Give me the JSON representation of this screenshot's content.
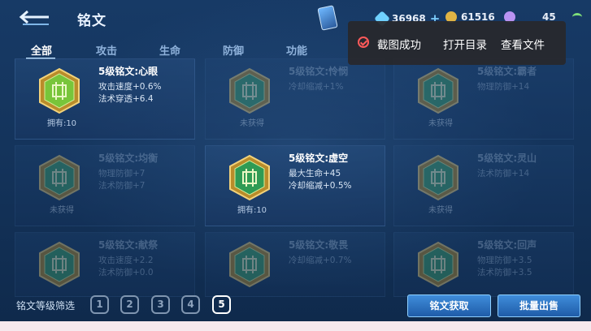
{
  "header": {
    "title": "铭文"
  },
  "resources": [
    {
      "name": "diamond",
      "value": "36968",
      "plus": "+"
    },
    {
      "name": "coupon",
      "value": "61516"
    },
    {
      "name": "gem",
      "value": "45"
    }
  ],
  "tabs": [
    {
      "label": "全部",
      "active": true
    },
    {
      "label": "攻击"
    },
    {
      "label": "生命"
    },
    {
      "label": "防御"
    },
    {
      "label": "功能"
    }
  ],
  "cards": [
    {
      "name": "5级铭文:心眼",
      "attrs": [
        "攻击速度+0.6%",
        "法术穿透+6.4"
      ],
      "owned": "拥有:10",
      "dim": false,
      "color": "#78c53a"
    },
    {
      "name": "5级铭文:怜悯",
      "attrs": [
        "冷却缩减+1%"
      ],
      "owned": "未获得",
      "dim": true,
      "color": "#3ea36a"
    },
    {
      "name": "5级铭文:霸者",
      "attrs": [
        "物理防御+14"
      ],
      "owned": "未获得",
      "dim": true,
      "color": "#3ea36a"
    },
    {
      "name": "5级铭文:均衡",
      "attrs": [
        "物理防御+7",
        "法术防御+7"
      ],
      "owned": "未获得",
      "dim": true,
      "color": "#3ea36a"
    },
    {
      "name": "5级铭文:虚空",
      "attrs": [
        "最大生命+45",
        "冷却缩减+0.5%"
      ],
      "owned": "拥有:10",
      "dim": false,
      "color": "#2f9b54"
    },
    {
      "name": "5级铭文:灵山",
      "attrs": [
        "法术防御+14"
      ],
      "owned": "未获得",
      "dim": true,
      "color": "#3ea36a"
    },
    {
      "name": "5级铭文:献祭",
      "attrs": [
        "攻击速度+2.2",
        "法术防御+0.0"
      ],
      "owned": "",
      "dim": true,
      "color": "#3ea36a"
    },
    {
      "name": "5级铭文:敬畏",
      "attrs": [
        "冷却缩减+0.7%"
      ],
      "owned": "",
      "dim": true,
      "color": "#3ea36a"
    },
    {
      "name": "5级铭文:回声",
      "attrs": [
        "物理防御+3.5",
        "法术防御+3.5"
      ],
      "owned": "",
      "dim": true,
      "color": "#3ea36a"
    }
  ],
  "filter": {
    "label": "铭文等级筛选",
    "levels": [
      "1",
      "2",
      "3",
      "4",
      "5"
    ],
    "active": "5"
  },
  "buttons": {
    "obtain": "铭文获取",
    "sell": "批量出售"
  },
  "toast": {
    "success": "截图成功",
    "open_dir": "打开目录",
    "view_file": "查看文件"
  }
}
